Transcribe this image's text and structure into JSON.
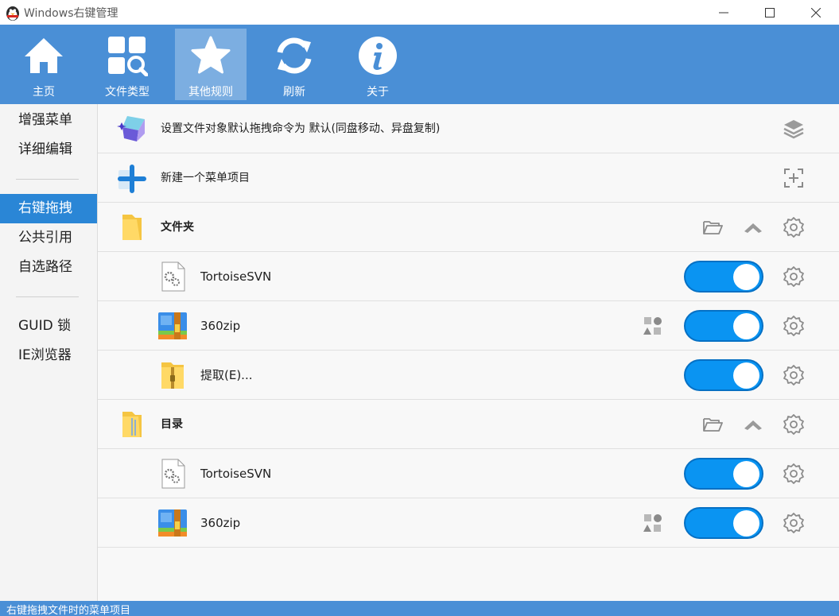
{
  "window": {
    "title": "Windows右键管理"
  },
  "toolbar": {
    "items": [
      {
        "label": "主页",
        "icon": "home-icon"
      },
      {
        "label": "文件类型",
        "icon": "file-type-search-icon"
      },
      {
        "label": "其他规则",
        "icon": "star-icon",
        "active": true
      },
      {
        "label": "刷新",
        "icon": "refresh-icon"
      },
      {
        "label": "关于",
        "icon": "info-icon"
      }
    ]
  },
  "sidebar": {
    "items": [
      {
        "label": "增强菜单"
      },
      {
        "label": "详细编辑"
      },
      {
        "label": "右键拖拽",
        "active": true
      },
      {
        "label": "公共引用"
      },
      {
        "label": "自选路径"
      },
      {
        "label": "GUID 锁"
      },
      {
        "label": "IE浏览器"
      }
    ]
  },
  "rows": {
    "set_default": {
      "label": "设置文件对象默认拖拽命令为 默认(同盘移动、异盘复制)"
    },
    "new_item": {
      "label": "新建一个菜单项目"
    },
    "folder_group": {
      "label": "文件夹"
    },
    "folder_tortoise": {
      "label": "TortoiseSVN",
      "enabled": true
    },
    "folder_360zip": {
      "label": "360zip",
      "enabled": true
    },
    "folder_extract": {
      "label": "提取(E)...",
      "enabled": true
    },
    "directory_group": {
      "label": "目录"
    },
    "dir_tortoise": {
      "label": "TortoiseSVN",
      "enabled": true
    },
    "dir_360zip": {
      "label": "360zip",
      "enabled": true
    }
  },
  "statusbar": {
    "text": "右键拖拽文件时的菜单项目"
  },
  "colors": {
    "toolbar": "#4a8fd6",
    "active_side": "#2a86d6",
    "toggle_on": "#0a94f2"
  }
}
